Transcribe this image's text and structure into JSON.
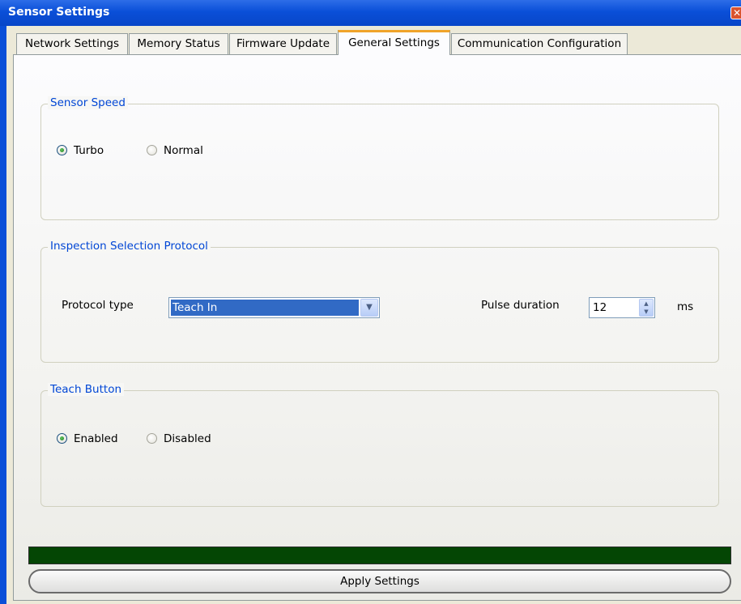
{
  "window": {
    "title": "Sensor Settings",
    "close_glyph": "✕"
  },
  "tabs": [
    {
      "label": "Network Settings",
      "active": false
    },
    {
      "label": "Memory Status",
      "active": false
    },
    {
      "label": "Firmware Update",
      "active": false
    },
    {
      "label": "General Settings",
      "active": true
    },
    {
      "label": "Communication Configuration",
      "active": false
    }
  ],
  "sensor_speed": {
    "title": "Sensor Speed",
    "options": [
      {
        "label": "Turbo",
        "selected": true
      },
      {
        "label": "Normal",
        "selected": false
      }
    ]
  },
  "inspection_protocol": {
    "title": "Inspection Selection Protocol",
    "protocol_label": "Protocol type",
    "protocol_value": "Teach In",
    "pulse_label": "Pulse duration",
    "pulse_value": "12",
    "pulse_unit": "ms"
  },
  "teach_button": {
    "title": "Teach Button",
    "options": [
      {
        "label": "Enabled",
        "selected": true
      },
      {
        "label": "Disabled",
        "selected": false
      }
    ]
  },
  "progress": {
    "value": 1.0,
    "color": "#044604"
  },
  "actions": {
    "apply_label": "Apply Settings"
  },
  "icons": {
    "close": "close-icon",
    "dropdown": "chevron-down-icon",
    "spin_up": "spin-up-icon",
    "spin_down": "spin-down-icon"
  }
}
